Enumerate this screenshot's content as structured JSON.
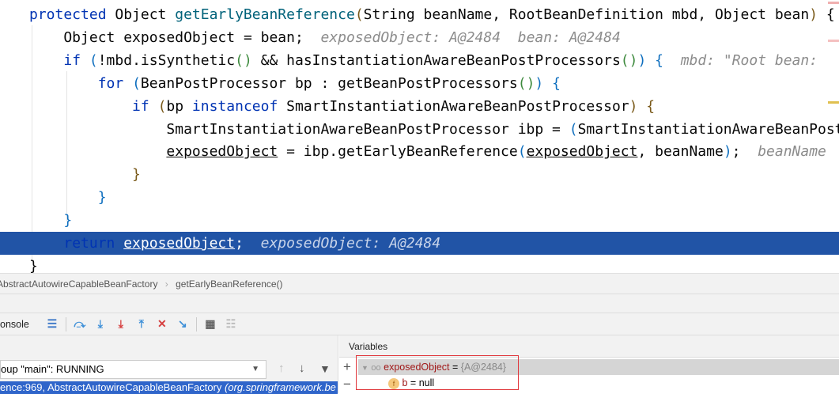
{
  "editor": {
    "lines": [
      [
        [
          "protected ",
          "kw"
        ],
        [
          "Object ",
          ""
        ],
        [
          "getEarlyBeanReference",
          "fn"
        ],
        [
          "(",
          "p3"
        ],
        [
          "String beanName, RootBeanDefinition mbd, Object bean",
          ""
        ],
        [
          ")",
          "p3"
        ],
        [
          " {",
          ""
        ]
      ],
      [
        [
          "    Object ",
          ""
        ],
        [
          "exposedObject",
          ""
        ],
        [
          " = bean;  ",
          ""
        ],
        [
          "exposedObject: A@2484  bean: A@2484",
          "hint"
        ]
      ],
      [
        [
          "    ",
          "kw"
        ],
        [
          "if ",
          "kw"
        ],
        [
          "(",
          "p1"
        ],
        [
          "!mbd.isSynthetic",
          ""
        ],
        [
          "()",
          "p2"
        ],
        [
          " && hasInstantiationAwareBeanPostProcessors",
          ""
        ],
        [
          "()",
          "p2"
        ],
        [
          ")",
          "p1"
        ],
        [
          " {",
          "p1"
        ],
        [
          "  mbd: \"Root bean: ",
          "hint"
        ]
      ],
      [
        [
          "        ",
          ""
        ],
        [
          "for ",
          "kw"
        ],
        [
          "(",
          "p1"
        ],
        [
          "BeanPostProcessor bp : getBeanPostProcessors",
          ""
        ],
        [
          "()",
          "p2"
        ],
        [
          ")",
          "p1"
        ],
        [
          " {",
          "p1"
        ]
      ],
      [
        [
          "            ",
          ""
        ],
        [
          "if ",
          "kw"
        ],
        [
          "(",
          "p3"
        ],
        [
          "bp ",
          ""
        ],
        [
          "instanceof ",
          "kw"
        ],
        [
          "SmartInstantiationAwareBeanPostProcessor",
          ""
        ],
        [
          ")",
          "p3"
        ],
        [
          " {",
          "p3"
        ]
      ],
      [
        [
          "                SmartInstantiationAwareBeanPostProcessor ibp = ",
          ""
        ],
        [
          "(",
          "p1"
        ],
        [
          "SmartInstantiationAwareBeanPostProcessor",
          ""
        ]
      ],
      [
        [
          "                ",
          ""
        ],
        [
          "exposedObject",
          "u"
        ],
        [
          " = ibp.getEarlyBeanReference",
          ""
        ],
        [
          "(",
          "p1"
        ],
        [
          "exposedObject",
          "u"
        ],
        [
          ", beanName",
          ""
        ],
        [
          ")",
          "p1"
        ],
        [
          ";  ",
          ""
        ],
        [
          "beanName",
          "hint"
        ]
      ],
      [
        [
          "            ",
          ""
        ],
        [
          "}",
          "p3"
        ]
      ],
      [
        [
          "        ",
          ""
        ],
        [
          "}",
          "p1"
        ]
      ],
      [
        [
          "    ",
          ""
        ],
        [
          "}",
          "p1"
        ]
      ],
      [
        [
          "    ",
          ""
        ],
        [
          "return ",
          "kw"
        ],
        [
          "exposedObject",
          "u"
        ],
        [
          ";  ",
          ""
        ],
        [
          "exposedObject: A@2484",
          "hint"
        ]
      ],
      [
        [
          "",
          ""
        ],
        [
          "}",
          ""
        ]
      ]
    ],
    "exec_line": 10
  },
  "breadcrumb": {
    "class": "AbstractAutowireCapableBeanFactory",
    "sep": "›",
    "method": "getEarlyBeanReference()"
  },
  "toolbar": {
    "console_label": "onsole"
  },
  "frames": {
    "thread": "oup \"main\": RUNNING",
    "selected_frame": "ence:969, AbstractAutowireCapableBeanFactory",
    "selected_frame_pkg": "(org.springframework.be"
  },
  "variables": {
    "title": "Variables",
    "items": [
      {
        "name": "exposedObject",
        "eq": " = ",
        "value": "{A@2484}"
      },
      {
        "name": "b",
        "eq": " = ",
        "value": "null"
      }
    ]
  },
  "colors": {
    "accent": "#2154a6",
    "highlight_box": "#e0353a"
  }
}
